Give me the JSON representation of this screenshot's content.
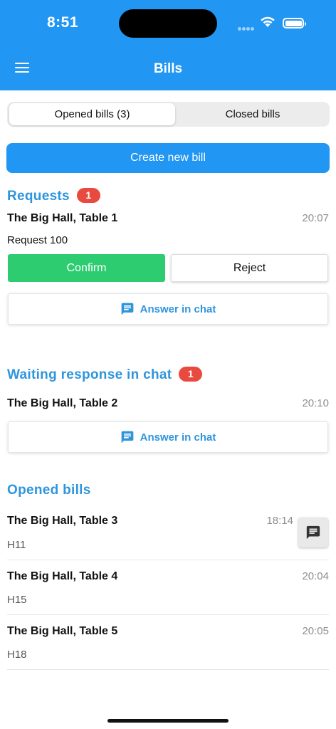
{
  "status_bar": {
    "time": "8:51"
  },
  "header": {
    "title": "Bills"
  },
  "tabs": [
    {
      "label": "Opened bills (3)",
      "active": true
    },
    {
      "label": "Closed bills",
      "active": false
    }
  ],
  "create_button": "Create new bill",
  "requests": {
    "title": "Requests",
    "count": "1",
    "item": {
      "name": "The Big Hall, Table 1",
      "time": "20:07",
      "text": "Request 100",
      "confirm_label": "Confirm",
      "reject_label": "Reject",
      "chat_label": "Answer in chat"
    }
  },
  "waiting": {
    "title": "Waiting response in chat",
    "count": "1",
    "item": {
      "name": "The Big Hall, Table 2",
      "time": "20:10",
      "chat_label": "Answer in chat"
    }
  },
  "opened": {
    "title": "Opened bills",
    "items": [
      {
        "name": "The Big Hall, Table 3",
        "time": "18:14",
        "code": "H11"
      },
      {
        "name": "The Big Hall, Table 4",
        "time": "20:04",
        "code": "H15"
      },
      {
        "name": "The Big Hall, Table 5",
        "time": "20:05",
        "code": "H18"
      }
    ]
  },
  "colors": {
    "header": "#2196f3",
    "accent": "#2e95dd",
    "confirm": "#2ecc71",
    "badge": "#e84a3f"
  }
}
